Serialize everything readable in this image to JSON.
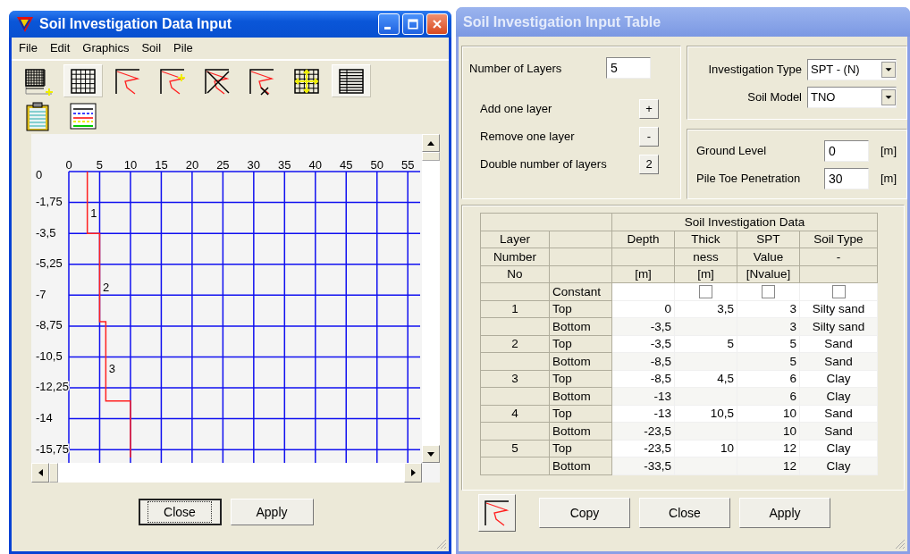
{
  "data_window": {
    "title": "Soil Investigation Data Input",
    "menu": [
      "File",
      "Edit",
      "Graphics",
      "Soil",
      "Pile"
    ],
    "toolbar": [
      {
        "kind": "grid-add",
        "selected": false
      },
      {
        "kind": "grid",
        "selected": true
      },
      {
        "kind": "profile",
        "selected": false
      },
      {
        "kind": "profile-add",
        "selected": false
      },
      {
        "kind": "profile-delete",
        "selected": false
      },
      {
        "kind": "profile-point-delete",
        "selected": false
      },
      {
        "kind": "grid-move",
        "selected": false
      },
      {
        "kind": "table",
        "selected": true
      },
      {
        "kind": "clipboard",
        "selected": false
      },
      {
        "kind": "legend",
        "selected": false
      }
    ],
    "chart": {
      "chart_data": {
        "type": "line",
        "x": [
          3,
          3,
          5,
          5,
          6,
          6,
          10,
          10
        ],
        "series": [
          {
            "color": "#ff2020",
            "values": [
              0,
              -3.5,
              -3.5,
              -8.5,
              -8.5,
              -13,
              -13,
              -16.2
            ]
          }
        ],
        "grid": true,
        "xlim": [
          0,
          57
        ],
        "ylim": [
          -16.5,
          0
        ],
        "xticks": [
          0,
          5,
          10,
          15,
          20,
          25,
          30,
          35,
          40,
          45,
          50,
          55
        ],
        "yticks": [
          0,
          {
            "value": -1.75,
            "label": "-1,75"
          },
          {
            "value": -3.5,
            "label": "-3,5"
          },
          {
            "value": -5.25,
            "label": "-5,25"
          },
          -7,
          {
            "value": -8.75,
            "label": "-8,75"
          },
          {
            "value": -10.5,
            "label": "-10,5"
          },
          {
            "value": -12.25,
            "label": "-12,25"
          },
          -14,
          {
            "value": -15.75,
            "label": "-15,75"
          }
        ],
        "annotations": [
          {
            "text": "1",
            "x": 3.5,
            "y": -2.4
          },
          {
            "text": "2",
            "x": 5.5,
            "y": -6.6
          },
          {
            "text": "3",
            "x": 6.5,
            "y": -11.2
          }
        ]
      }
    },
    "buttons": [
      {
        "label": "Close",
        "focused": true
      },
      {
        "label": "Apply",
        "focused": false
      }
    ]
  },
  "table_window": {
    "title": "Soil Investigation Input Table",
    "layers": {
      "label": "Number of Layers",
      "value": "5"
    },
    "layer_actions": [
      {
        "label": "Add one layer",
        "button": "+"
      },
      {
        "label": "Remove one layer",
        "button": "-"
      },
      {
        "label": "Double number of layers",
        "button": "2"
      }
    ],
    "investigation_type": {
      "label": "Investigation Type",
      "value": "SPT - (N)"
    },
    "soil_model": {
      "label": "Soil Model",
      "value": "TNO"
    },
    "ground_level": {
      "label": "Ground Level",
      "value": "0",
      "unit": "[m]"
    },
    "pile_toe": {
      "label": "Pile Toe Penetration",
      "value": "30",
      "unit": "[m]"
    },
    "table": {
      "group_header": "Soil Investigation Data",
      "header_rows": [
        {
          "layer": "Layer",
          "depth": "Depth",
          "thickness": "Thick",
          "spt": "SPT",
          "soil_type": "Soil Type"
        },
        {
          "layer": "Number",
          "thickness": "ness",
          "spt": "Value",
          "soil_type": "-"
        },
        {
          "layer": "No",
          "depth": "[m]",
          "thickness": "[m]",
          "spt": "[Nvalue]"
        }
      ],
      "constant_row": {
        "label": "Constant",
        "checks": [
          {
            "checked": false
          },
          {
            "checked": false
          },
          {
            "checked": false
          }
        ]
      },
      "rows": [
        {
          "layer": "1",
          "position": "Top",
          "depth": "0",
          "thickness": "3,5",
          "spt": "3",
          "soil_type": "Silty sand"
        },
        {
          "position": "Bottom",
          "depth": "-3,5",
          "spt": "3",
          "soil_type": "Silty sand"
        },
        {
          "layer": "2",
          "position": "Top",
          "depth": "-3,5",
          "thickness": "5",
          "spt": "5",
          "soil_type": "Sand"
        },
        {
          "position": "Bottom",
          "depth": "-8,5",
          "spt": "5",
          "soil_type": "Sand"
        },
        {
          "layer": "3",
          "position": "Top",
          "depth": "-8,5",
          "thickness": "4,5",
          "spt": "6",
          "soil_type": "Clay"
        },
        {
          "position": "Bottom",
          "depth": "-13",
          "spt": "6",
          "soil_type": "Clay"
        },
        {
          "layer": "4",
          "position": "Top",
          "depth": "-13",
          "thickness": "10,5",
          "spt": "10",
          "soil_type": "Sand"
        },
        {
          "position": "Bottom",
          "depth": "-23,5",
          "spt": "10",
          "soil_type": "Sand"
        },
        {
          "layer": "5",
          "position": "Top",
          "depth": "-23,5",
          "thickness": "10",
          "spt": "12",
          "soil_type": "Clay"
        },
        {
          "position": "Bottom",
          "depth": "-33,5",
          "spt": "12",
          "soil_type": "Clay"
        }
      ]
    },
    "buttons": [
      "Copy",
      "Close",
      "Apply"
    ]
  }
}
